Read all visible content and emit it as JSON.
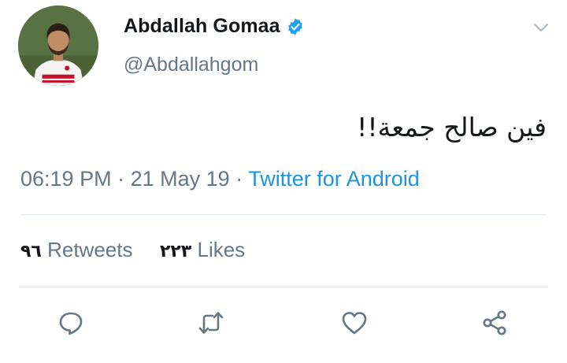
{
  "user": {
    "display_name": "Abdallah Gomaa",
    "handle": "@Abdallahgom",
    "verified_icon": "verified-badge-icon",
    "avatar_icon": "profile-photo"
  },
  "tweet": {
    "text": "فين صالح جمعة!!",
    "time": "06:19 PM",
    "separator": "·",
    "date": "21 May 19",
    "source": "Twitter for Android"
  },
  "stats": {
    "retweets_count": "٩٦",
    "retweets_label": "Retweets",
    "likes_count": "٢٢٣",
    "likes_label": "Likes"
  },
  "actions": [
    "reply-icon",
    "retweet-icon",
    "like-icon",
    "share-icon"
  ],
  "colors": {
    "text": "#14171a",
    "secondary": "#657786",
    "link": "#1b95e0",
    "verified": "#1da1f2",
    "divider": "#e1e8ed"
  }
}
